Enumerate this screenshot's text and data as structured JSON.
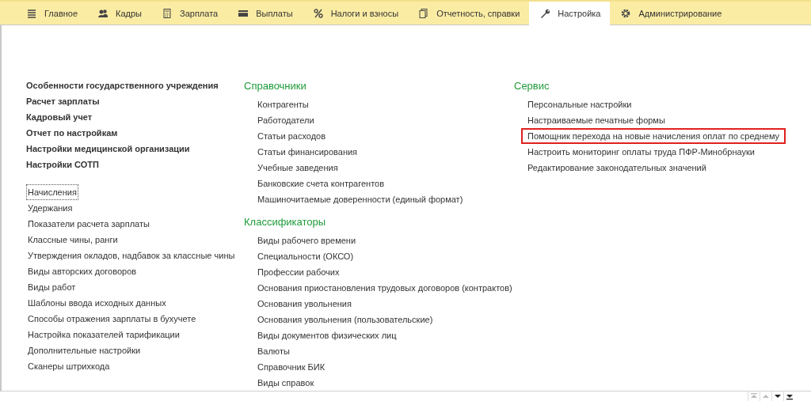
{
  "tabs": [
    {
      "label": "Главное",
      "selected": false
    },
    {
      "label": "Кадры",
      "selected": false
    },
    {
      "label": "Зарплата",
      "selected": false
    },
    {
      "label": "Выплаты",
      "selected": false
    },
    {
      "label": "Налоги и взносы",
      "selected": false
    },
    {
      "label": "Отчетность, справки",
      "selected": false
    },
    {
      "label": "Настройка",
      "selected": true
    },
    {
      "label": "Администрирование",
      "selected": false
    }
  ],
  "left": {
    "bold_links": [
      "Особенности государственного учреждения",
      "Расчет зарплаты",
      "Кадровый учет",
      "Отчет по настройкам",
      "Настройки медицинской организации",
      "Настройки СОТП"
    ],
    "links": [
      {
        "label": "Начисления",
        "focused": true
      },
      {
        "label": "Удержания",
        "focused": false
      },
      {
        "label": "Показатели расчета зарплаты",
        "focused": false
      },
      {
        "label": "Классные чины, ранги",
        "focused": false
      },
      {
        "label": "Утверждения окладов, надбавок за классные чины",
        "focused": false
      },
      {
        "label": "Виды авторских договоров",
        "focused": false
      },
      {
        "label": "Виды работ",
        "focused": false
      },
      {
        "label": "Шаблоны ввода исходных данных",
        "focused": false
      },
      {
        "label": "Способы отражения зарплаты в бухучете",
        "focused": false
      },
      {
        "label": "Настройка показателей тарификации",
        "focused": false
      },
      {
        "label": "Дополнительные настройки",
        "focused": false
      },
      {
        "label": "Сканеры штрихкода",
        "focused": false
      }
    ]
  },
  "middle": [
    {
      "title": "Справочники",
      "items": [
        "Контрагенты",
        "Работодатели",
        "Статьи расходов",
        "Статьи финансирования",
        "Учебные заведения",
        "Банковские счета контрагентов",
        "Машиночитаемые доверенности (единый формат)"
      ]
    },
    {
      "title": "Классификаторы",
      "items": [
        "Виды рабочего времени",
        "Специальности (ОКСО)",
        "Профессии рабочих",
        "Основания приостановления трудовых договоров (контрактов)",
        "Основания увольнения",
        "Основания увольнения (пользовательские)",
        "Виды документов физических лиц",
        "Валюты",
        "Справочник БИК",
        "Виды справок"
      ]
    }
  ],
  "right": {
    "title": "Сервис",
    "items": [
      {
        "label": "Персональные настройки",
        "highlighted": false
      },
      {
        "label": "Настраиваемые печатные формы",
        "highlighted": false
      },
      {
        "label": "Помощник перехода на новые начисления оплат по среднему",
        "highlighted": true
      },
      {
        "label": "Настроить мониторинг оплаты труда ПФР-Минобрнауки",
        "highlighted": false
      },
      {
        "label": "Редактирование законодательных значений",
        "highlighted": false
      }
    ]
  },
  "scroll_buttons": [
    {
      "kind": "first",
      "disabled": true
    },
    {
      "kind": "up",
      "disabled": true
    },
    {
      "kind": "down",
      "disabled": false
    },
    {
      "kind": "last",
      "disabled": false
    }
  ]
}
